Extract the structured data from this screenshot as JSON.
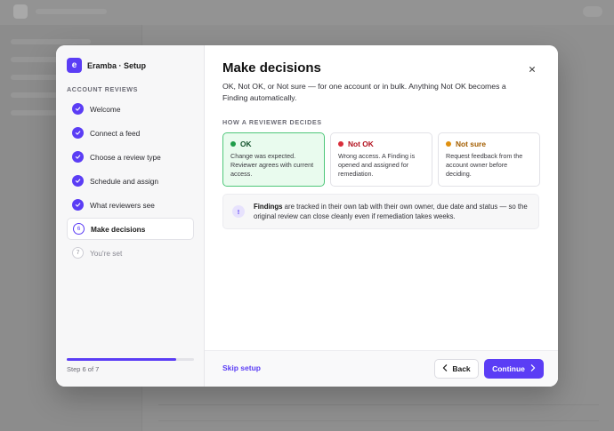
{
  "brand": {
    "logo_letter": "e",
    "name": "Eramba · Setup",
    "accent": "#5b3df5"
  },
  "sidebar": {
    "section_title": "ACCOUNT REVIEWS",
    "steps": [
      {
        "label": "Welcome",
        "state": "done"
      },
      {
        "label": "Connect a feed",
        "state": "done"
      },
      {
        "label": "Choose a review type",
        "state": "done"
      },
      {
        "label": "Schedule and assign",
        "state": "done"
      },
      {
        "label": "What reviewers see",
        "state": "done"
      },
      {
        "number": "6",
        "label": "Make decisions",
        "state": "current"
      },
      {
        "number": "7",
        "label": "You're set",
        "state": "todo"
      }
    ],
    "progress_fraction": 0.857,
    "step_count": "Step 6 of 7"
  },
  "main": {
    "title": "Make decisions",
    "subtitle": "OK, Not OK, or Not sure — for one account or in bulk. Anything Not OK becomes a Finding automatically.",
    "section_title": "HOW A REVIEWER DECIDES",
    "options": [
      {
        "label": "OK",
        "color": "#1f9d4a",
        "selected": true,
        "desc": "Change was expected. Reviewer agrees with current access."
      },
      {
        "label": "Not OK",
        "color": "#d92d3a",
        "selected": false,
        "desc": "Wrong access. A Finding is opened and assigned for remediation."
      },
      {
        "label": "Not sure",
        "color": "#e0900f",
        "selected": false,
        "desc": "Request feedback from the account owner before deciding."
      }
    ],
    "note": {
      "icon": "!",
      "bold": "Findings",
      "text": " are tracked in their own tab with their own owner, due date and status — so the original review can close cleanly even if remediation takes weeks."
    }
  },
  "footer": {
    "skip_label": "Skip setup",
    "back_label": "Back",
    "continue_label": "Continue"
  }
}
